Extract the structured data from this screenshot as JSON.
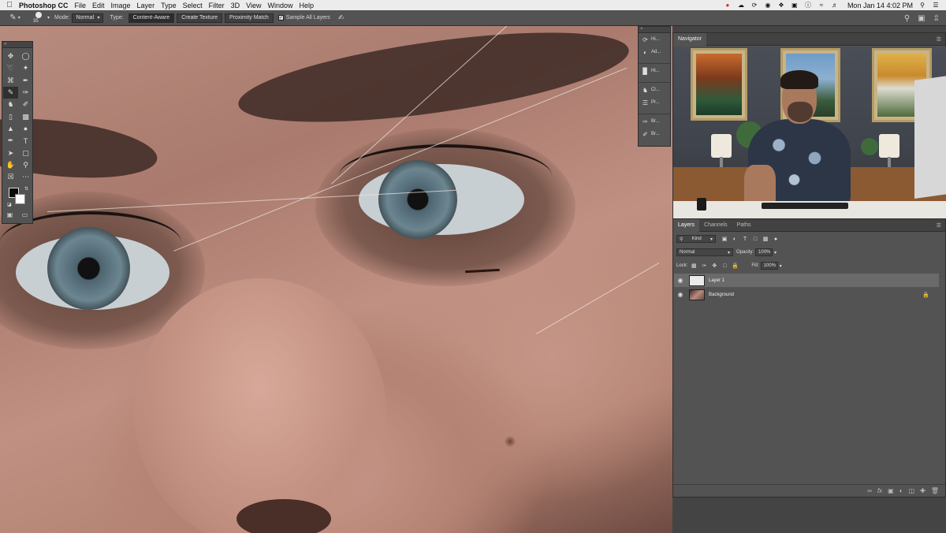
{
  "menubar": {
    "apple_icon": "apple-icon",
    "app_name": "Photoshop CC",
    "items": [
      "File",
      "Edit",
      "Image",
      "Layer",
      "Type",
      "Select",
      "Filter",
      "3D",
      "View",
      "Window",
      "Help"
    ],
    "clock": "Mon Jan 14  4:02 PM"
  },
  "options_bar": {
    "brush_size": "35",
    "mode_label": "Mode:",
    "mode_value": "Normal",
    "type_label": "Type:",
    "type_options": [
      "Content-Aware",
      "Create Texture",
      "Proximity Match"
    ],
    "type_selected": "Content-Aware",
    "sample_all_layers": "Sample All Layers"
  },
  "dock": {
    "items": [
      "Hi...",
      "Ad...",
      "Hi...",
      "Cl...",
      "Pr...",
      "Br...",
      "Br..."
    ]
  },
  "navigator": {
    "title": "Navigator"
  },
  "layers_panel": {
    "tabs": [
      "Layers",
      "Channels",
      "Paths"
    ],
    "filter_kind": "Kind",
    "blend_mode": "Normal",
    "opacity_label": "Opacity:",
    "opacity_value": "100%",
    "lock_label": "Lock:",
    "fill_label": "Fill:",
    "fill_value": "100%",
    "layers": [
      {
        "name": "Layer 1",
        "selected": true,
        "locked": false
      },
      {
        "name": "Background",
        "selected": false,
        "locked": true
      }
    ]
  },
  "colors": {
    "panel_bg": "#535353",
    "panel_dark": "#424242",
    "selected_layer": "#6a6a6a",
    "foreground": "#0a0a0a",
    "background": "#ffffff"
  }
}
